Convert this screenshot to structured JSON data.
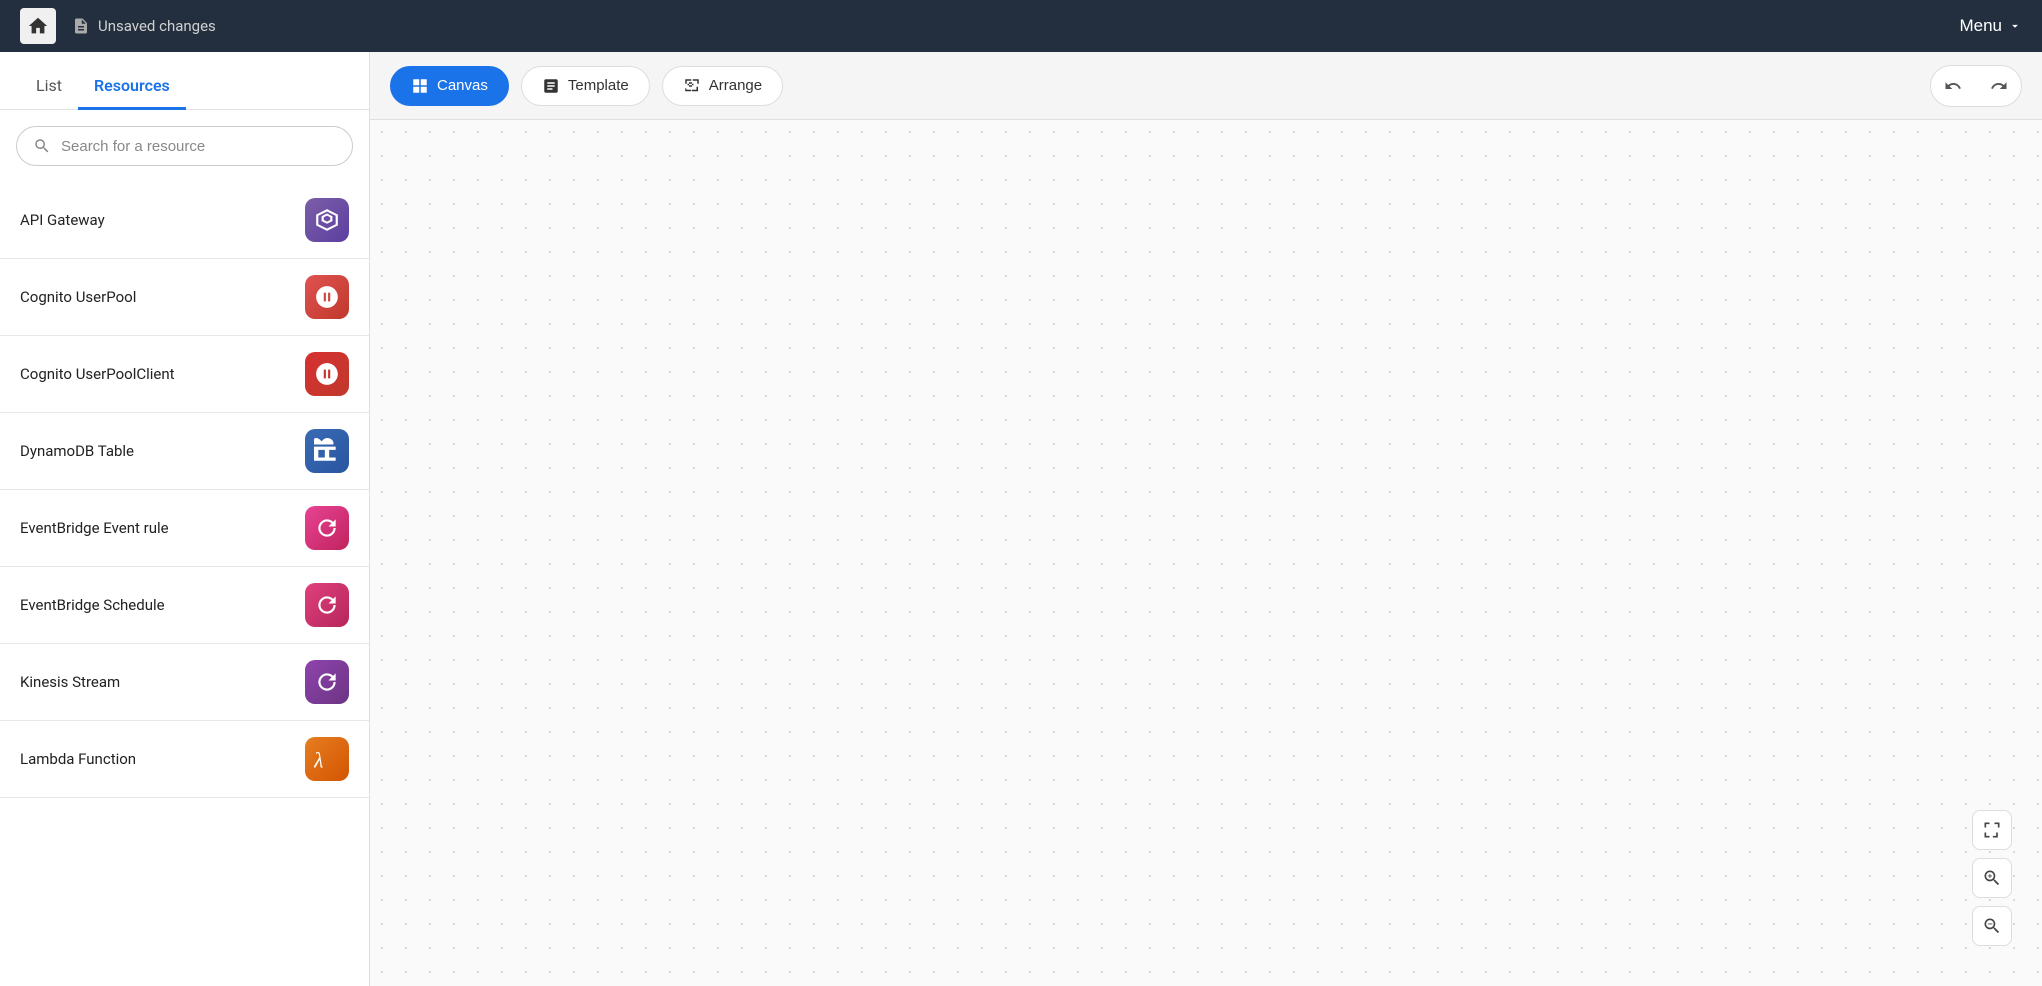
{
  "topbar": {
    "unsaved_label": "Unsaved changes",
    "menu_label": "Menu"
  },
  "sidebar": {
    "tab_list": "List",
    "tab_resources": "Resources",
    "search_placeholder": "Search for a resource",
    "resources": [
      {
        "name": "API Gateway",
        "icon_type": "icon-purple",
        "icon_char": "⊞"
      },
      {
        "name": "Cognito UserPool",
        "icon_type": "icon-red",
        "icon_char": "⊡"
      },
      {
        "name": "Cognito UserPoolClient",
        "icon_type": "icon-red2",
        "icon_char": "⊡"
      },
      {
        "name": "DynamoDB Table",
        "icon_type": "icon-blue",
        "icon_char": "🗄"
      },
      {
        "name": "EventBridge Event rule",
        "icon_type": "icon-pink",
        "icon_char": "⟳"
      },
      {
        "name": "EventBridge Schedule",
        "icon_type": "icon-pink2",
        "icon_char": "⟳"
      },
      {
        "name": "Kinesis Stream",
        "icon_type": "icon-violet",
        "icon_char": "⟳"
      },
      {
        "name": "Lambda Function",
        "icon_type": "icon-orange",
        "icon_char": "λ"
      }
    ]
  },
  "toolbar": {
    "canvas_label": "Canvas",
    "template_label": "Template",
    "arrange_label": "Arrange"
  },
  "zoom": {
    "fit_icon": "⛶",
    "zoom_in_icon": "⊕",
    "zoom_out_icon": "⊖"
  }
}
